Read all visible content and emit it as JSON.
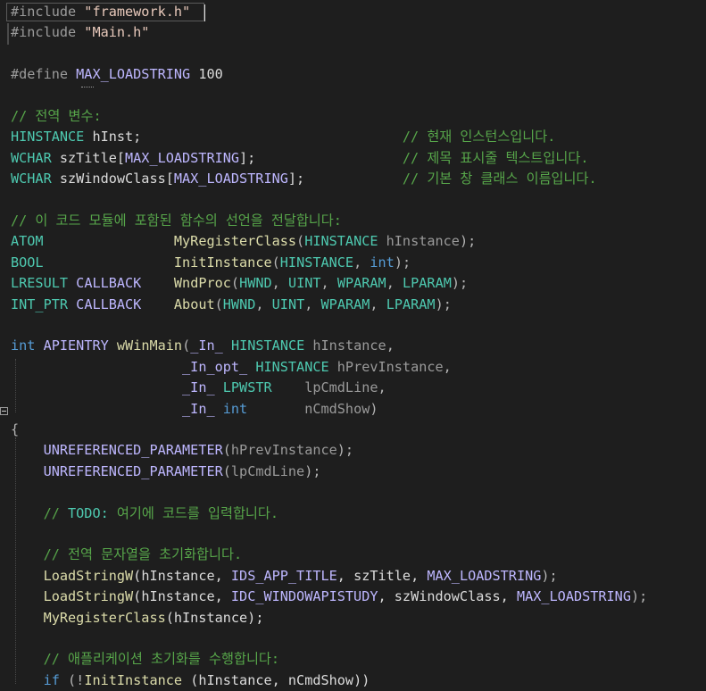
{
  "editor": {
    "language": "C++",
    "current_line": 1,
    "lines": [
      {
        "tokens": [
          {
            "t": "#include ",
            "c": "pre"
          },
          {
            "t": "\"framework.h\"",
            "c": "str"
          }
        ]
      },
      {
        "tokens": [
          {
            "t": "#include ",
            "c": "pre"
          },
          {
            "t": "\"Main.h\"",
            "c": "str"
          }
        ]
      },
      {
        "tokens": []
      },
      {
        "tokens": [
          {
            "t": "#define ",
            "c": "pre"
          },
          {
            "t": "MAX_LOADSTRING",
            "c": "mac"
          },
          {
            "t": " 100",
            "c": "var"
          }
        ]
      },
      {
        "tokens": []
      },
      {
        "tokens": [
          {
            "t": "// 전역 변수:",
            "c": "cmt"
          }
        ]
      },
      {
        "tokens": [
          {
            "t": "HINSTANCE",
            "c": "type"
          },
          {
            "t": " hInst;                                ",
            "c": "var"
          },
          {
            "t": "// 현재 인스턴스입니다.",
            "c": "cmt"
          }
        ]
      },
      {
        "tokens": [
          {
            "t": "WCHAR",
            "c": "type"
          },
          {
            "t": " szTitle[",
            "c": "var"
          },
          {
            "t": "MAX_LOADSTRING",
            "c": "mac"
          },
          {
            "t": "];                  ",
            "c": "var"
          },
          {
            "t": "// 제목 표시줄 텍스트입니다.",
            "c": "cmt"
          }
        ]
      },
      {
        "tokens": [
          {
            "t": "WCHAR",
            "c": "type"
          },
          {
            "t": " szWindowClass[",
            "c": "var"
          },
          {
            "t": "MAX_LOADSTRING",
            "c": "mac"
          },
          {
            "t": "];            ",
            "c": "var"
          },
          {
            "t": "// 기본 창 클래스 이름입니다.",
            "c": "cmt"
          }
        ]
      },
      {
        "tokens": []
      },
      {
        "tokens": [
          {
            "t": "// 이 코드 모듈에 포함된 함수의 선언을 전달합니다:",
            "c": "cmt"
          }
        ]
      },
      {
        "tokens": [
          {
            "t": "ATOM",
            "c": "type"
          },
          {
            "t": "                ",
            "c": "var"
          },
          {
            "t": "MyRegisterClass",
            "c": "fn"
          },
          {
            "t": "(",
            "c": "pun"
          },
          {
            "t": "HINSTANCE",
            "c": "type"
          },
          {
            "t": " hInstance",
            "c": "par"
          },
          {
            "t": ");",
            "c": "pun"
          }
        ]
      },
      {
        "tokens": [
          {
            "t": "BOOL",
            "c": "type"
          },
          {
            "t": "                ",
            "c": "var"
          },
          {
            "t": "InitInstance",
            "c": "fn"
          },
          {
            "t": "(",
            "c": "pun"
          },
          {
            "t": "HINSTANCE",
            "c": "type"
          },
          {
            "t": ", ",
            "c": "pun"
          },
          {
            "t": "int",
            "c": "kw"
          },
          {
            "t": ");",
            "c": "pun"
          }
        ]
      },
      {
        "tokens": [
          {
            "t": "LRESULT",
            "c": "type"
          },
          {
            "t": " ",
            "c": "var"
          },
          {
            "t": "CALLBACK",
            "c": "mac"
          },
          {
            "t": "    ",
            "c": "var"
          },
          {
            "t": "WndProc",
            "c": "fn"
          },
          {
            "t": "(",
            "c": "pun"
          },
          {
            "t": "HWND",
            "c": "type"
          },
          {
            "t": ", ",
            "c": "pun"
          },
          {
            "t": "UINT",
            "c": "type"
          },
          {
            "t": ", ",
            "c": "pun"
          },
          {
            "t": "WPARAM",
            "c": "type"
          },
          {
            "t": ", ",
            "c": "pun"
          },
          {
            "t": "LPARAM",
            "c": "type"
          },
          {
            "t": ");",
            "c": "pun"
          }
        ]
      },
      {
        "tokens": [
          {
            "t": "INT_PTR",
            "c": "type"
          },
          {
            "t": " ",
            "c": "var"
          },
          {
            "t": "CALLBACK",
            "c": "mac"
          },
          {
            "t": "    ",
            "c": "var"
          },
          {
            "t": "About",
            "c": "fn"
          },
          {
            "t": "(",
            "c": "pun"
          },
          {
            "t": "HWND",
            "c": "type"
          },
          {
            "t": ", ",
            "c": "pun"
          },
          {
            "t": "UINT",
            "c": "type"
          },
          {
            "t": ", ",
            "c": "pun"
          },
          {
            "t": "WPARAM",
            "c": "type"
          },
          {
            "t": ", ",
            "c": "pun"
          },
          {
            "t": "LPARAM",
            "c": "type"
          },
          {
            "t": ");",
            "c": "pun"
          }
        ]
      },
      {
        "tokens": []
      },
      {
        "tokens": [
          {
            "t": "int",
            "c": "kw"
          },
          {
            "t": " ",
            "c": "var"
          },
          {
            "t": "APIENTRY",
            "c": "mac"
          },
          {
            "t": " ",
            "c": "var"
          },
          {
            "t": "wWinMain",
            "c": "fn"
          },
          {
            "t": "(",
            "c": "pun"
          },
          {
            "t": "_In_",
            "c": "mac"
          },
          {
            "t": " ",
            "c": "var"
          },
          {
            "t": "HINSTANCE",
            "c": "type"
          },
          {
            "t": " hInstance",
            "c": "par"
          },
          {
            "t": ",",
            "c": "pun"
          }
        ]
      },
      {
        "tokens": [
          {
            "t": "                     ",
            "c": "var"
          },
          {
            "t": "_In_opt_",
            "c": "mac"
          },
          {
            "t": " ",
            "c": "var"
          },
          {
            "t": "HINSTANCE",
            "c": "type"
          },
          {
            "t": " hPrevInstance",
            "c": "par"
          },
          {
            "t": ",",
            "c": "pun"
          }
        ]
      },
      {
        "tokens": [
          {
            "t": "                     ",
            "c": "var"
          },
          {
            "t": "_In_",
            "c": "mac"
          },
          {
            "t": " ",
            "c": "var"
          },
          {
            "t": "LPWSTR",
            "c": "type"
          },
          {
            "t": "    ",
            "c": "var"
          },
          {
            "t": "lpCmdLine",
            "c": "par"
          },
          {
            "t": ",",
            "c": "pun"
          }
        ]
      },
      {
        "tokens": [
          {
            "t": "                     ",
            "c": "var"
          },
          {
            "t": "_In_",
            "c": "mac"
          },
          {
            "t": " ",
            "c": "var"
          },
          {
            "t": "int",
            "c": "kw"
          },
          {
            "t": "       ",
            "c": "var"
          },
          {
            "t": "nCmdShow",
            "c": "par"
          },
          {
            "t": ")",
            "c": "pun"
          }
        ]
      },
      {
        "tokens": [
          {
            "t": "{",
            "c": "pun"
          }
        ]
      },
      {
        "tokens": [
          {
            "t": "    ",
            "c": "var"
          },
          {
            "t": "UNREFERENCED_PARAMETER",
            "c": "mac"
          },
          {
            "t": "(",
            "c": "pun"
          },
          {
            "t": "hPrevInstance",
            "c": "par"
          },
          {
            "t": ");",
            "c": "pun"
          }
        ]
      },
      {
        "tokens": [
          {
            "t": "    ",
            "c": "var"
          },
          {
            "t": "UNREFERENCED_PARAMETER",
            "c": "mac"
          },
          {
            "t": "(",
            "c": "pun"
          },
          {
            "t": "lpCmdLine",
            "c": "par"
          },
          {
            "t": ");",
            "c": "pun"
          }
        ]
      },
      {
        "tokens": []
      },
      {
        "tokens": [
          {
            "t": "    ",
            "c": "var"
          },
          {
            "t": "// ",
            "c": "cmt"
          },
          {
            "t": "TODO:",
            "c": "todo"
          },
          {
            "t": " 여기에 코드를 입력합니다.",
            "c": "cmt"
          }
        ]
      },
      {
        "tokens": []
      },
      {
        "tokens": [
          {
            "t": "    ",
            "c": "var"
          },
          {
            "t": "// 전역 문자열을 초기화합니다.",
            "c": "cmt"
          }
        ]
      },
      {
        "tokens": [
          {
            "t": "    ",
            "c": "var"
          },
          {
            "t": "LoadStringW",
            "c": "fn"
          },
          {
            "t": "(hInstance, ",
            "c": "var"
          },
          {
            "t": "IDS_APP_TITLE",
            "c": "mac"
          },
          {
            "t": ", szTitle, ",
            "c": "var"
          },
          {
            "t": "MAX_LOADSTRING",
            "c": "mac"
          },
          {
            "t": ");",
            "c": "pun"
          }
        ]
      },
      {
        "tokens": [
          {
            "t": "    ",
            "c": "var"
          },
          {
            "t": "LoadStringW",
            "c": "fn"
          },
          {
            "t": "(hInstance, ",
            "c": "var"
          },
          {
            "t": "IDC_WINDOWAPISTUDY",
            "c": "mac"
          },
          {
            "t": ", szWindowClass, ",
            "c": "var"
          },
          {
            "t": "MAX_LOADSTRING",
            "c": "mac"
          },
          {
            "t": ");",
            "c": "pun"
          }
        ]
      },
      {
        "tokens": [
          {
            "t": "    ",
            "c": "var"
          },
          {
            "t": "MyRegisterClass",
            "c": "fn"
          },
          {
            "t": "(hInstance);",
            "c": "var"
          }
        ]
      },
      {
        "tokens": []
      },
      {
        "tokens": [
          {
            "t": "    ",
            "c": "var"
          },
          {
            "t": "// 애플리케이션 초기화를 수행합니다:",
            "c": "cmt"
          }
        ]
      },
      {
        "tokens": [
          {
            "t": "    ",
            "c": "var"
          },
          {
            "t": "if",
            "c": "kw"
          },
          {
            "t": " (!",
            "c": "pun"
          },
          {
            "t": "InitInstance",
            "c": "fn"
          },
          {
            "t": " (hInstance, nCmdShow))",
            "c": "var"
          }
        ]
      }
    ]
  }
}
